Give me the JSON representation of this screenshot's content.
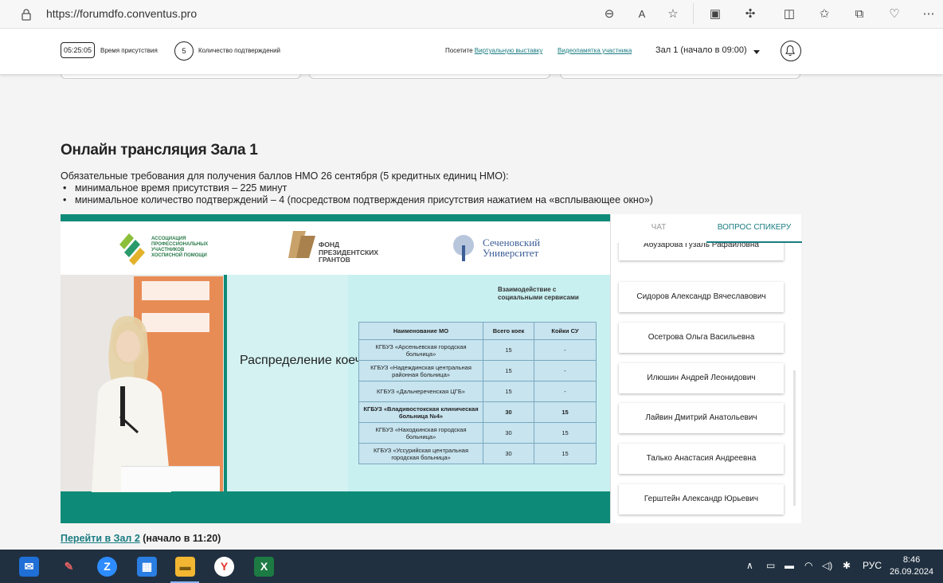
{
  "browser": {
    "url": "https://forumdfo.conventus.pro"
  },
  "header": {
    "timer": "05:25:05",
    "timer_label": "Время присутствия",
    "confirmations_count": "5",
    "confirmations_label": "Количество подтверждений",
    "visit_prefix": "Посетите",
    "virtual_exhibition_link": "Виртуальную выставку",
    "memo_link": "Видеопамятка участника",
    "hall_select": "Зал 1 (начало в  09:00)"
  },
  "main": {
    "title": "Онлайн трансляция Зала 1",
    "requirements_intro": "Обязательные требования для получения баллов НМО 26 сентября (5 кредитных единиц НМО):",
    "requirements": [
      "минимальное время присутствия – 225 минут",
      "минимальное количество подтверждений – 4 (посредством подтверждения присутствия нажатием на «всплывающее окно»)"
    ],
    "next_hall_link": "Перейти в Зал 2",
    "next_hall_suffix": " (начало в 11:20)"
  },
  "video": {
    "logo1": "АССОЦИАЦИЯ ПРОФЕССИОНАЛЬНЫХ УЧАСТНИКОВ ХОСПИСНОЙ ПОМОЩИ",
    "logo2": "ФОНД ПРЕЗИДЕНТСКИХ ГРАНТОВ",
    "logo3": "Сеченовский Университет",
    "slide_title": "Распределение коечного фонда в Приморском крае:",
    "slide_subtitle": "Взаимодействие с социальными сервисами",
    "table_headers": [
      "Наименование МО",
      "Всего коек",
      "Койки СУ"
    ],
    "table_rows": [
      [
        "КГБУЗ «Арсеньевская городская больница»",
        "15",
        "-"
      ],
      [
        "КГБУЗ «Надеждинская центральная районная больница»",
        "15",
        "-"
      ],
      [
        "КГБУЗ «Дальнереченская ЦГБ»",
        "15",
        "-"
      ],
      [
        "КГБУЗ «Владивостокская клиническая больница №4»",
        "30",
        "15"
      ],
      [
        "КГБУЗ «Находкинская городская больница»",
        "30",
        "15"
      ],
      [
        "КГБУЗ «Уссурийская центральная городская больница»",
        "30",
        "15"
      ]
    ]
  },
  "side_panel": {
    "tabs": [
      "ЧАТ",
      "ВОПРОС СПИКЕРУ"
    ],
    "speakers": [
      "Абузарова Гузаль Рафаиловна",
      "Сидоров Александр Вячеславович",
      "Осетрова Ольга Васильевна",
      "Илюшин Андрей Леонидович",
      "Лайвин Дмитрий Анатольевич",
      "Талько Анастасия Андреевна",
      "Герштейн Александр Юрьевич"
    ]
  },
  "taskbar": {
    "language": "РУС",
    "time": "8:46",
    "date": "26.09.2024"
  },
  "colors": {
    "accent": "#1a7c82",
    "video_green": "#0e8b78",
    "taskbar": "#203040"
  }
}
